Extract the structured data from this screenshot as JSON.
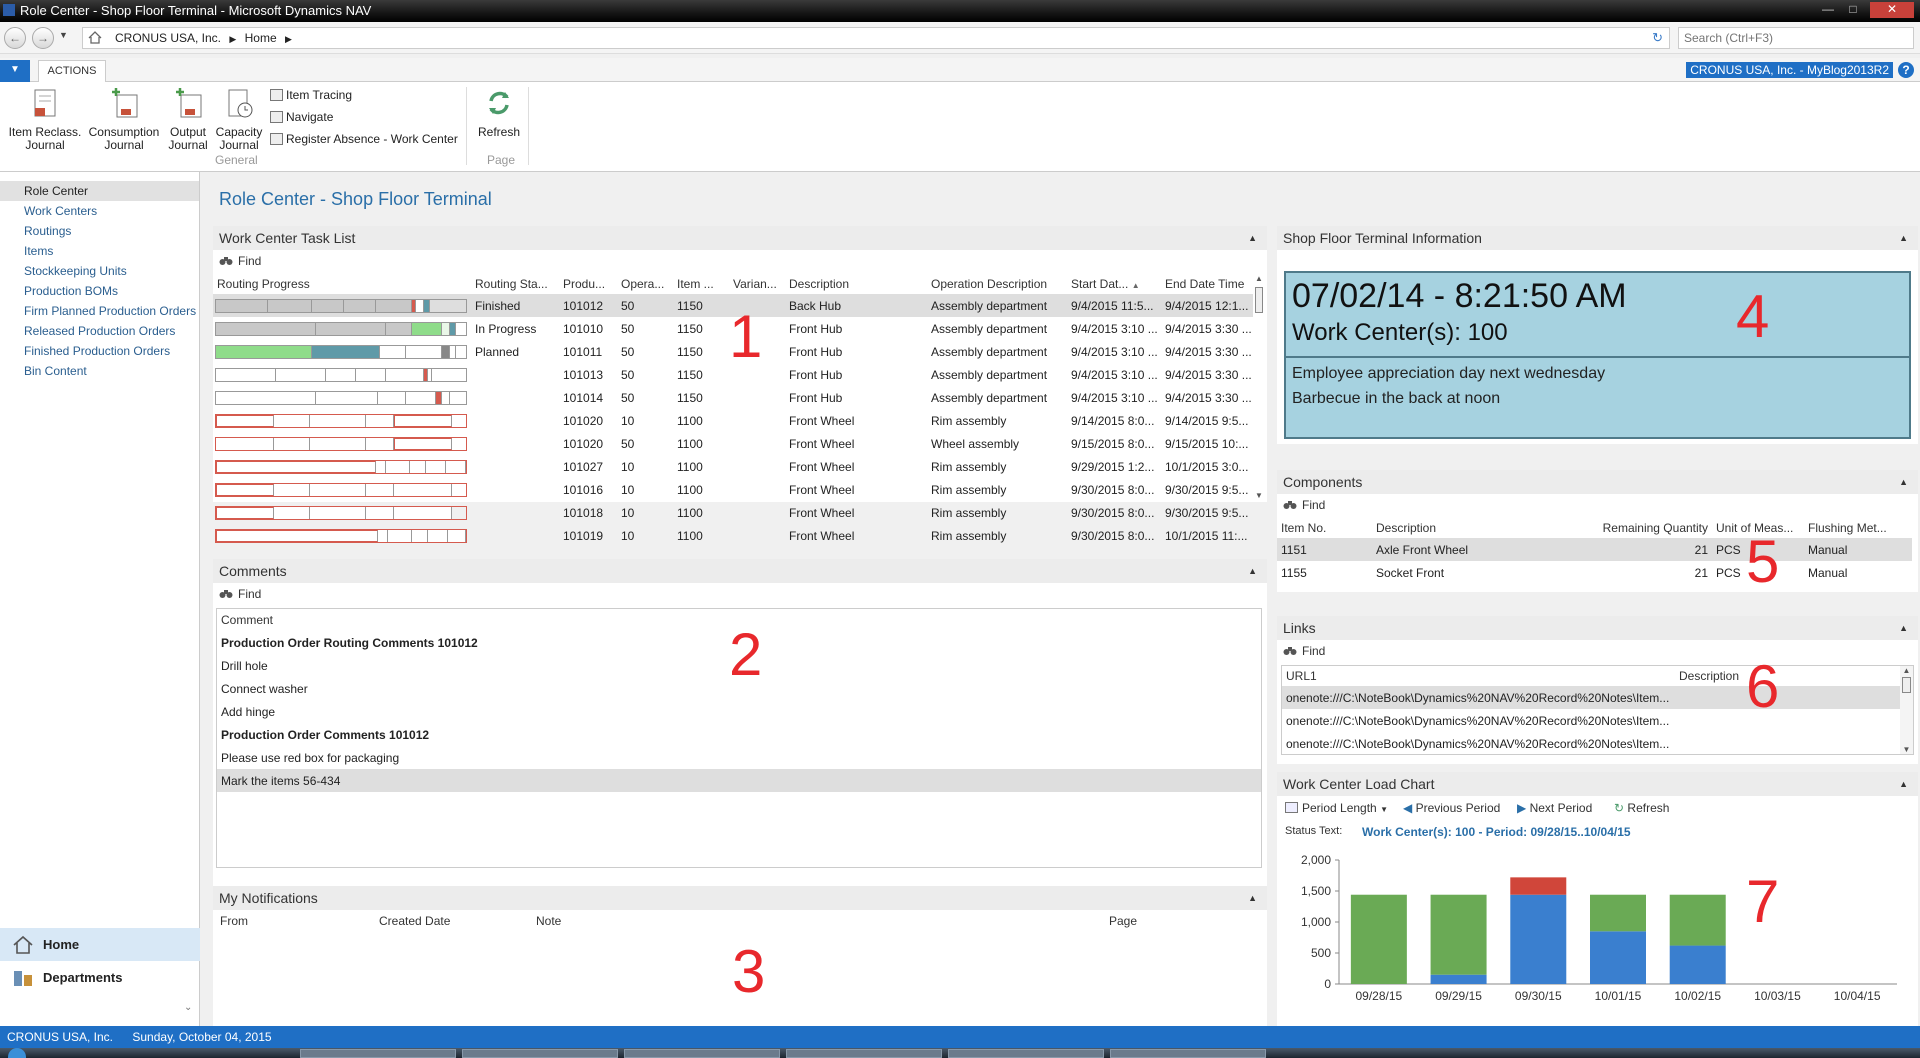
{
  "window": {
    "title": "Role Center - Shop Floor Terminal - Microsoft Dynamics NAV"
  },
  "address": {
    "company": "CRONUS USA, Inc.",
    "page": "Home",
    "search_placeholder": "Search (Ctrl+F3)"
  },
  "ribbon": {
    "tab": "ACTIONS",
    "company_badge": "CRONUS USA, Inc. - MyBlog2013R2",
    "buttons": [
      {
        "line1": "Item Reclass.",
        "line2": "Journal"
      },
      {
        "line1": "Consumption",
        "line2": "Journal"
      },
      {
        "line1": "Output",
        "line2": "Journal"
      },
      {
        "line1": "Capacity",
        "line2": "Journal"
      }
    ],
    "small_buttons": [
      "Item Tracing",
      "Navigate",
      "Register Absence - Work Center"
    ],
    "group_general": "General",
    "refresh": "Refresh",
    "group_page": "Page"
  },
  "nav": {
    "items": [
      "Role Center",
      "Work Centers",
      "Routings",
      "Items",
      "Stockkeeping Units",
      "Production BOMs",
      "Firm Planned Production Orders",
      "Released Production Orders",
      "Finished Production Orders",
      "Bin Content"
    ],
    "home": "Home",
    "departments": "Departments"
  },
  "page_title": "Role Center - Shop Floor Terminal",
  "find": "Find",
  "tasklist": {
    "title": "Work Center Task List",
    "columns": [
      "Routing Progress",
      "Routing Sta...",
      "Produ...",
      "Opera...",
      "Item ...",
      "Varian...",
      "Description",
      "Operation Description",
      "Start Dat...",
      "End Date Time"
    ],
    "rows": [
      {
        "status": "Finished",
        "prod": "101012",
        "op": "50",
        "item": "1150",
        "desc": "Back Hub",
        "opdesc": "Assembly department",
        "start": "9/4/2015 11:5...",
        "end": "9/4/2015 12:1..."
      },
      {
        "status": "In Progress",
        "prod": "101010",
        "op": "50",
        "item": "1150",
        "desc": "Front Hub",
        "opdesc": "Assembly department",
        "start": "9/4/2015 3:10 ...",
        "end": "9/4/2015 3:30 ..."
      },
      {
        "status": "Planned",
        "prod": "101011",
        "op": "50",
        "item": "1150",
        "desc": "Front Hub",
        "opdesc": "Assembly department",
        "start": "9/4/2015 3:10 ...",
        "end": "9/4/2015 3:30 ..."
      },
      {
        "status": "",
        "prod": "101013",
        "op": "50",
        "item": "1150",
        "desc": "Front Hub",
        "opdesc": "Assembly department",
        "start": "9/4/2015 3:10 ...",
        "end": "9/4/2015 3:30 ..."
      },
      {
        "status": "",
        "prod": "101014",
        "op": "50",
        "item": "1150",
        "desc": "Front Hub",
        "opdesc": "Assembly department",
        "start": "9/4/2015 3:10 ...",
        "end": "9/4/2015 3:30 ..."
      },
      {
        "status": "",
        "prod": "101020",
        "op": "10",
        "item": "1100",
        "desc": "Front Wheel",
        "opdesc": "Rim assembly",
        "start": "9/14/2015 8:0...",
        "end": "9/14/2015 9:5..."
      },
      {
        "status": "",
        "prod": "101020",
        "op": "50",
        "item": "1100",
        "desc": "Front Wheel",
        "opdesc": "Wheel assembly",
        "start": "9/15/2015 8:0...",
        "end": "9/15/2015 10:..."
      },
      {
        "status": "",
        "prod": "101027",
        "op": "10",
        "item": "1100",
        "desc": "Front Wheel",
        "opdesc": "Rim assembly",
        "start": "9/29/2015 1:2...",
        "end": "10/1/2015 3:0..."
      },
      {
        "status": "",
        "prod": "101016",
        "op": "10",
        "item": "1100",
        "desc": "Front Wheel",
        "opdesc": "Rim assembly",
        "start": "9/30/2015 8:0...",
        "end": "9/30/2015 9:5..."
      },
      {
        "status": "",
        "prod": "101018",
        "op": "10",
        "item": "1100",
        "desc": "Front Wheel",
        "opdesc": "Rim assembly",
        "start": "9/30/2015 8:0...",
        "end": "9/30/2015 9:5..."
      },
      {
        "status": "",
        "prod": "101019",
        "op": "10",
        "item": "1100",
        "desc": "Front Wheel",
        "opdesc": "Rim assembly",
        "start": "9/30/2015 8:0...",
        "end": "10/1/2015 11:..."
      }
    ]
  },
  "comments": {
    "title": "Comments",
    "column": "Comment",
    "rows": [
      {
        "text": "Production Order Routing Comments 101012",
        "bold": true
      },
      {
        "text": "Drill hole",
        "bold": false
      },
      {
        "text": "Connect washer",
        "bold": false
      },
      {
        "text": "Add hinge",
        "bold": false
      },
      {
        "text": "Production Order Comments 101012",
        "bold": true
      },
      {
        "text": "Please use red box for packaging",
        "bold": false
      },
      {
        "text": "Mark the items 56-434",
        "bold": false
      }
    ]
  },
  "notifications": {
    "title": "My Notifications",
    "columns": [
      "From",
      "Created Date",
      "Note",
      "Page"
    ]
  },
  "sfinfo": {
    "title": "Shop Floor Terminal Information",
    "datetime": "07/02/14 -  8:21:50 AM",
    "workcenter": "Work Center(s): 100",
    "msg1": "Employee appreciation day next wednesday",
    "msg2": "Barbecue in the back at noon"
  },
  "components": {
    "title": "Components",
    "columns": [
      "Item No.",
      "Description",
      "Remaining Quantity",
      "Unit of Meas...",
      "Flushing Met..."
    ],
    "rows": [
      {
        "item": "1151",
        "desc": "Axle Front Wheel",
        "qty": "21",
        "uom": "PCS",
        "flush": "Manual"
      },
      {
        "item": "1155",
        "desc": "Socket Front",
        "qty": "21",
        "uom": "PCS",
        "flush": "Manual"
      }
    ]
  },
  "links": {
    "title": "Links",
    "columns": [
      "URL1",
      "Description"
    ],
    "rows": [
      "onenote:///C:\\NoteBook\\Dynamics%20NAV%20Record%20Notes\\Item...",
      "onenote:///C:\\NoteBook\\Dynamics%20NAV%20Record%20Notes\\Item...",
      "onenote:///C:\\NoteBook\\Dynamics%20NAV%20Record%20Notes\\Item..."
    ]
  },
  "loadchart": {
    "title": "Work Center Load Chart",
    "period_length": "Period Length",
    "previous": "Previous Period",
    "next": "Next Period",
    "refresh": "Refresh",
    "status_label": "Status Text:",
    "status_value": "Work Center(s): 100 - Period: 09/28/15..10/04/15"
  },
  "chart_data": {
    "type": "bar",
    "stacked": true,
    "categories": [
      "09/28/15",
      "09/29/15",
      "09/30/15",
      "10/01/15",
      "10/02/15",
      "10/03/15",
      "10/04/15"
    ],
    "series": [
      {
        "color": "#3a7fcf",
        "values": [
          0,
          150,
          1440,
          850,
          620,
          0,
          0
        ]
      },
      {
        "color": "#6aaa55",
        "values": [
          1440,
          1290,
          0,
          590,
          820,
          0,
          0
        ]
      },
      {
        "color": "#d0463a",
        "values": [
          0,
          0,
          280,
          0,
          0,
          0,
          0
        ]
      }
    ],
    "ylim": [
      0,
      2000
    ],
    "yticks": [
      "0",
      "500",
      "1,000",
      "1,500",
      "2,000"
    ]
  },
  "annotations": [
    "1",
    "2",
    "3",
    "4",
    "5",
    "6",
    "7"
  ],
  "statusbar": {
    "company": "CRONUS USA, Inc.",
    "date": "Sunday, October 04, 2015"
  },
  "colors": {
    "accent": "#1f6fc5",
    "title_blue": "#2a6fa8",
    "annotation_red": "#e8282c",
    "info_bg": "#a6d2e0"
  }
}
